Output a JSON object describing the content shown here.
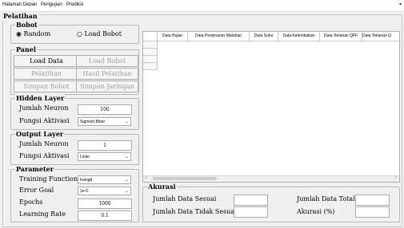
{
  "menu": {
    "items": [
      "Halaman Depan",
      "Pengujian",
      "Prediksi"
    ],
    "overflow_arrow": "▾"
  },
  "frame": {
    "title": "Pelatihan"
  },
  "bobot": {
    "title": "Bobot",
    "radio_random": "Random",
    "radio_load": "Load Bobot",
    "selected": "Random"
  },
  "panel": {
    "title": "Panel",
    "load_data": "Load Data",
    "load_bobot": "Load Bobot",
    "pelatihan": "Pelatihan",
    "hasil_pelatihan": "Hasil Pelatihan",
    "simpan_bobot": "Simpan Bobot",
    "simpan_jaringan": "Simpan Jaringan"
  },
  "hidden_layer": {
    "title": "Hidden Layer",
    "neuron_label": "Jumlah Neuron",
    "neuron_value": "100",
    "activation_label": "Fungsi Aktivasi",
    "activation_value": "Sigmoid Biner"
  },
  "output_layer": {
    "title": "Output Layer",
    "neuron_label": "Jumlah Neuron",
    "neuron_value": "1",
    "activation_label": "Fungsi Aktivasi",
    "activation_value": "Linier"
  },
  "parameter": {
    "title": "Parameter",
    "training_label": "Training Function",
    "training_value": "traingd",
    "error_label": "Error Goal",
    "error_value": "1e-6",
    "epochs_label": "Epochs",
    "epochs_value": "1000",
    "lr_label": "Learning Rate",
    "lr_value": "0.1"
  },
  "table": {
    "columns": [
      "Data Hujan",
      "Data Penyinaran Matahari",
      "Data Suhu",
      "Data Kelembaban",
      "Data Tekanan QFF",
      "Data Tekanan Q"
    ],
    "scroll_left": "‹",
    "scroll_right": "›"
  },
  "akurasi": {
    "title": "Akurasi",
    "jumlah_sesuai": "Jumlah Data Sesuai",
    "jumlah_tidak_sesuai": "Jumlah Data Tidak Sesuai",
    "jumlah_total": "Jumlah Data Total",
    "akurasi_pct": "Akurasi (%)"
  }
}
